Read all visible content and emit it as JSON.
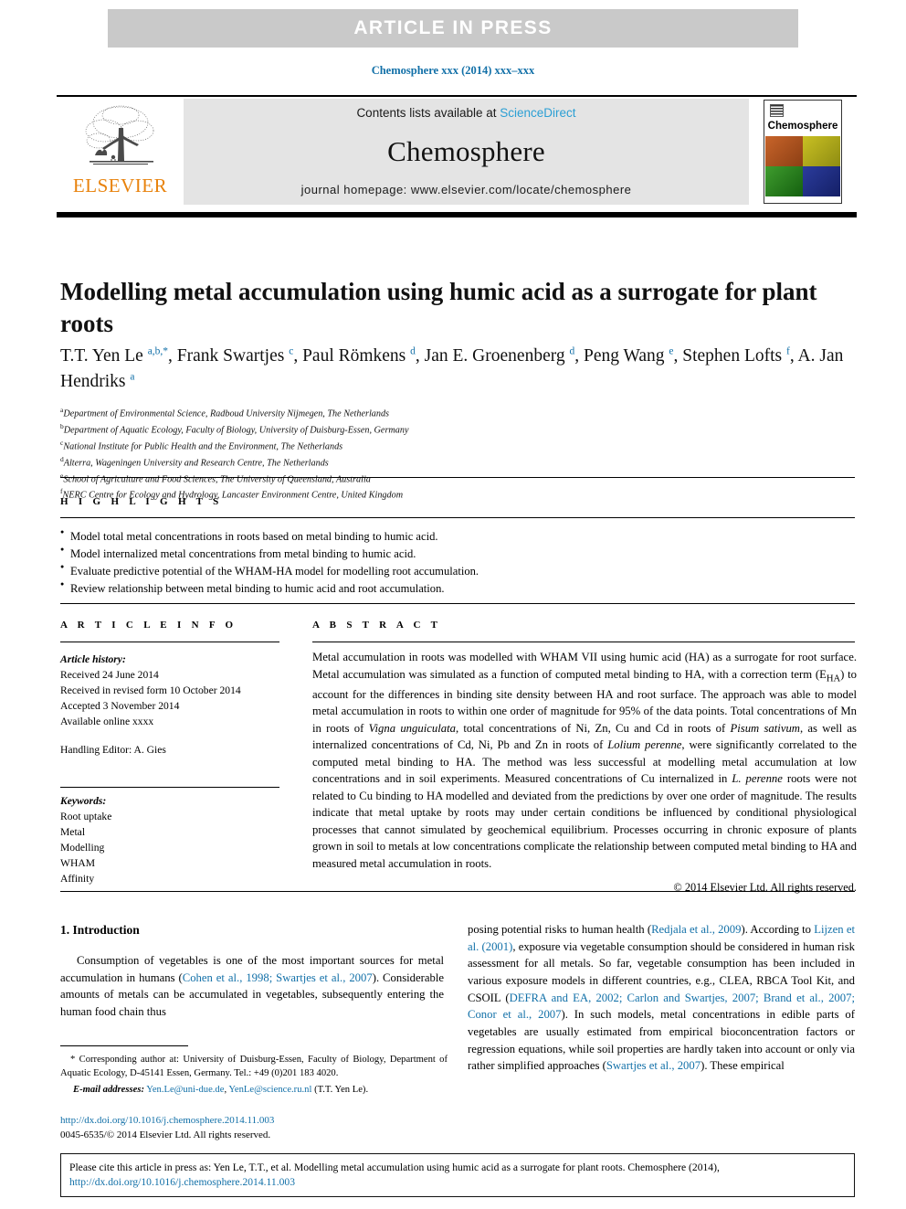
{
  "banner": {
    "text": "ARTICLE  IN  PRESS"
  },
  "running_head": {
    "text": "Chemosphere xxx (2014) xxx–xxx"
  },
  "masthead": {
    "publisher": "ELSEVIER",
    "contents_prefix": "Contents lists available at ",
    "sciencedirect": "ScienceDirect",
    "journal_name": "Chemosphere",
    "homepage": "journal homepage: www.elsevier.com/locate/chemosphere",
    "cover_title": "Chemosphere"
  },
  "article": {
    "title": "Modelling metal accumulation using humic acid as a surrogate for plant roots",
    "authors_line1_prefix": "T.T. Yen Le ",
    "authors_html": "T.T. Yen Le <sup>a,b,*</sup>, Frank Swartjes <sup>c</sup>, Paul Römkens <sup>d</sup>, Jan E. Groenenberg <sup>d</sup>, Peng Wang <sup>e</sup>, Stephen Lofts <sup>f</sup>, A. Jan Hendriks <sup>a</sup>",
    "affiliations": [
      {
        "mark": "a",
        "text": "Department of Environmental Science, Radboud University Nijmegen, The Netherlands"
      },
      {
        "mark": "b",
        "text": "Department of Aquatic Ecology, Faculty of Biology, University of Duisburg-Essen, Germany"
      },
      {
        "mark": "c",
        "text": "National Institute for Public Health and the Environment, The Netherlands"
      },
      {
        "mark": "d",
        "text": "Alterra, Wageningen University and Research Centre, The Netherlands"
      },
      {
        "mark": "e",
        "text": "School of Agriculture and Food Sciences, The University of Queensland, Australia"
      },
      {
        "mark": "f",
        "text": "NERC Centre for Ecology and Hydrology, Lancaster Environment Centre, United Kingdom"
      }
    ]
  },
  "highlights": {
    "heading": "H I G H L I G H T S",
    "items": [
      "Model total metal concentrations in roots based on metal binding to humic acid.",
      "Model internalized metal concentrations from metal binding to humic acid.",
      "Evaluate predictive potential of the WHAM-HA model for modelling root accumulation.",
      "Review relationship between metal binding to humic acid and root accumulation."
    ]
  },
  "article_info": {
    "heading": "A R T I C L E    I N F O",
    "history_label": "Article history:",
    "history": [
      "Received 24 June 2014",
      "Received in revised form 10 October 2014",
      "Accepted 3 November 2014",
      "Available online xxxx"
    ],
    "handling_editor": "Handling Editor: A. Gies",
    "keywords_label": "Keywords:",
    "keywords": [
      "Root uptake",
      "Metal",
      "Modelling",
      "WHAM",
      "Affinity"
    ]
  },
  "abstract": {
    "heading": "A B S T R A C T",
    "html": "Metal accumulation in roots was modelled with WHAM VII using humic acid (HA) as a surrogate for root surface. Metal accumulation was simulated as a function of computed metal binding to HA, with a correction term (E<sub>HA</sub>) to account for the differences in binding site density between HA and root surface. The approach was able to model metal accumulation in roots to within one order of magnitude for 95% of the data points. Total concentrations of Mn in roots of <i>Vigna unguiculata</i>, total concentrations of Ni, Zn, Cu and Cd in roots of <i>Pisum sativum</i>, as well as internalized concentrations of Cd, Ni, Pb and Zn in roots of <i>Lolium perenne</i>, were significantly correlated to the computed metal binding to HA. The method was less successful at modelling metal accumulation at low concentrations and in soil experiments. Measured concentrations of Cu internalized in <i>L. perenne</i> roots were not related to Cu binding to HA modelled and deviated from the predictions by over one order of magnitude. The results indicate that metal uptake by roots may under certain conditions be influenced by conditional physiological processes that cannot simulated by geochemical equilibrium. Processes occurring in chronic exposure of plants grown in soil to metals at low concentrations complicate the relationship between computed metal binding to HA and measured metal accumulation in roots.",
    "copyright": "© 2014 Elsevier Ltd. All rights reserved."
  },
  "body": {
    "section_title": "1. Introduction",
    "left_html": "Consumption of vegetables is one of the most important sources for metal accumulation in humans (<span class=\"lnk\">Cohen et al., 1998; Swartjes et al., 2007</span>). Considerable amounts of metals can be accumulated in vegetables, subsequently entering the human food chain thus",
    "right_html": "posing potential risks to human health (<span class=\"lnk\">Redjala et al., 2009</span>). According to <span class=\"lnk\">Lijzen et al. (2001)</span>, exposure via vegetable consumption should be considered in human risk assessment for all metals. So far, vegetable consumption has been included in various exposure models in different countries, e.g., CLEA, RBCA Tool Kit, and CSOIL (<span class=\"lnk\">DEFRA and EA, 2002; Carlon and Swartjes, 2007; Brand et al., 2007; Conor et al., 2007</span>). In such models, metal concentrations in edible parts of vegetables are usually estimated from empirical bioconcentration factors or regression equations, while soil properties are hardly taken into account or only via rather simplified approaches (<span class=\"lnk\">Swartjes et al., 2007</span>). These empirical"
  },
  "footnote": {
    "corresponding_html": "* Corresponding author at: University of Duisburg-Essen, Faculty of Biology, Department of Aquatic Ecology, D-45141 Essen, Germany. Tel.: +49 (0)201 183 4020.",
    "email_label": "E-mail addresses:",
    "email_1": "Yen.Le@uni-due.de",
    "email_2": "YenLe@science.ru.nl",
    "email_suffix": "(T.T. Yen Le).",
    "doi": "http://dx.doi.org/10.1016/j.chemosphere.2014.11.003",
    "issn_line": "0045-6535/© 2014 Elsevier Ltd. All rights reserved."
  },
  "cite_box": {
    "text": "Please cite this article in press as: Yen Le, T.T., et al. Modelling metal accumulation using humic acid as a surrogate for plant roots. Chemosphere (2014),",
    "link": "http://dx.doi.org/10.1016/j.chemosphere.2014.11.003"
  },
  "colors": {
    "link": "#1270a8",
    "banner_bg": "#c9c9c9",
    "masthead_bg": "#e4e4e4",
    "elsevier_orange": "#e8820c",
    "sciencedirect_blue": "#2b9fd4"
  }
}
